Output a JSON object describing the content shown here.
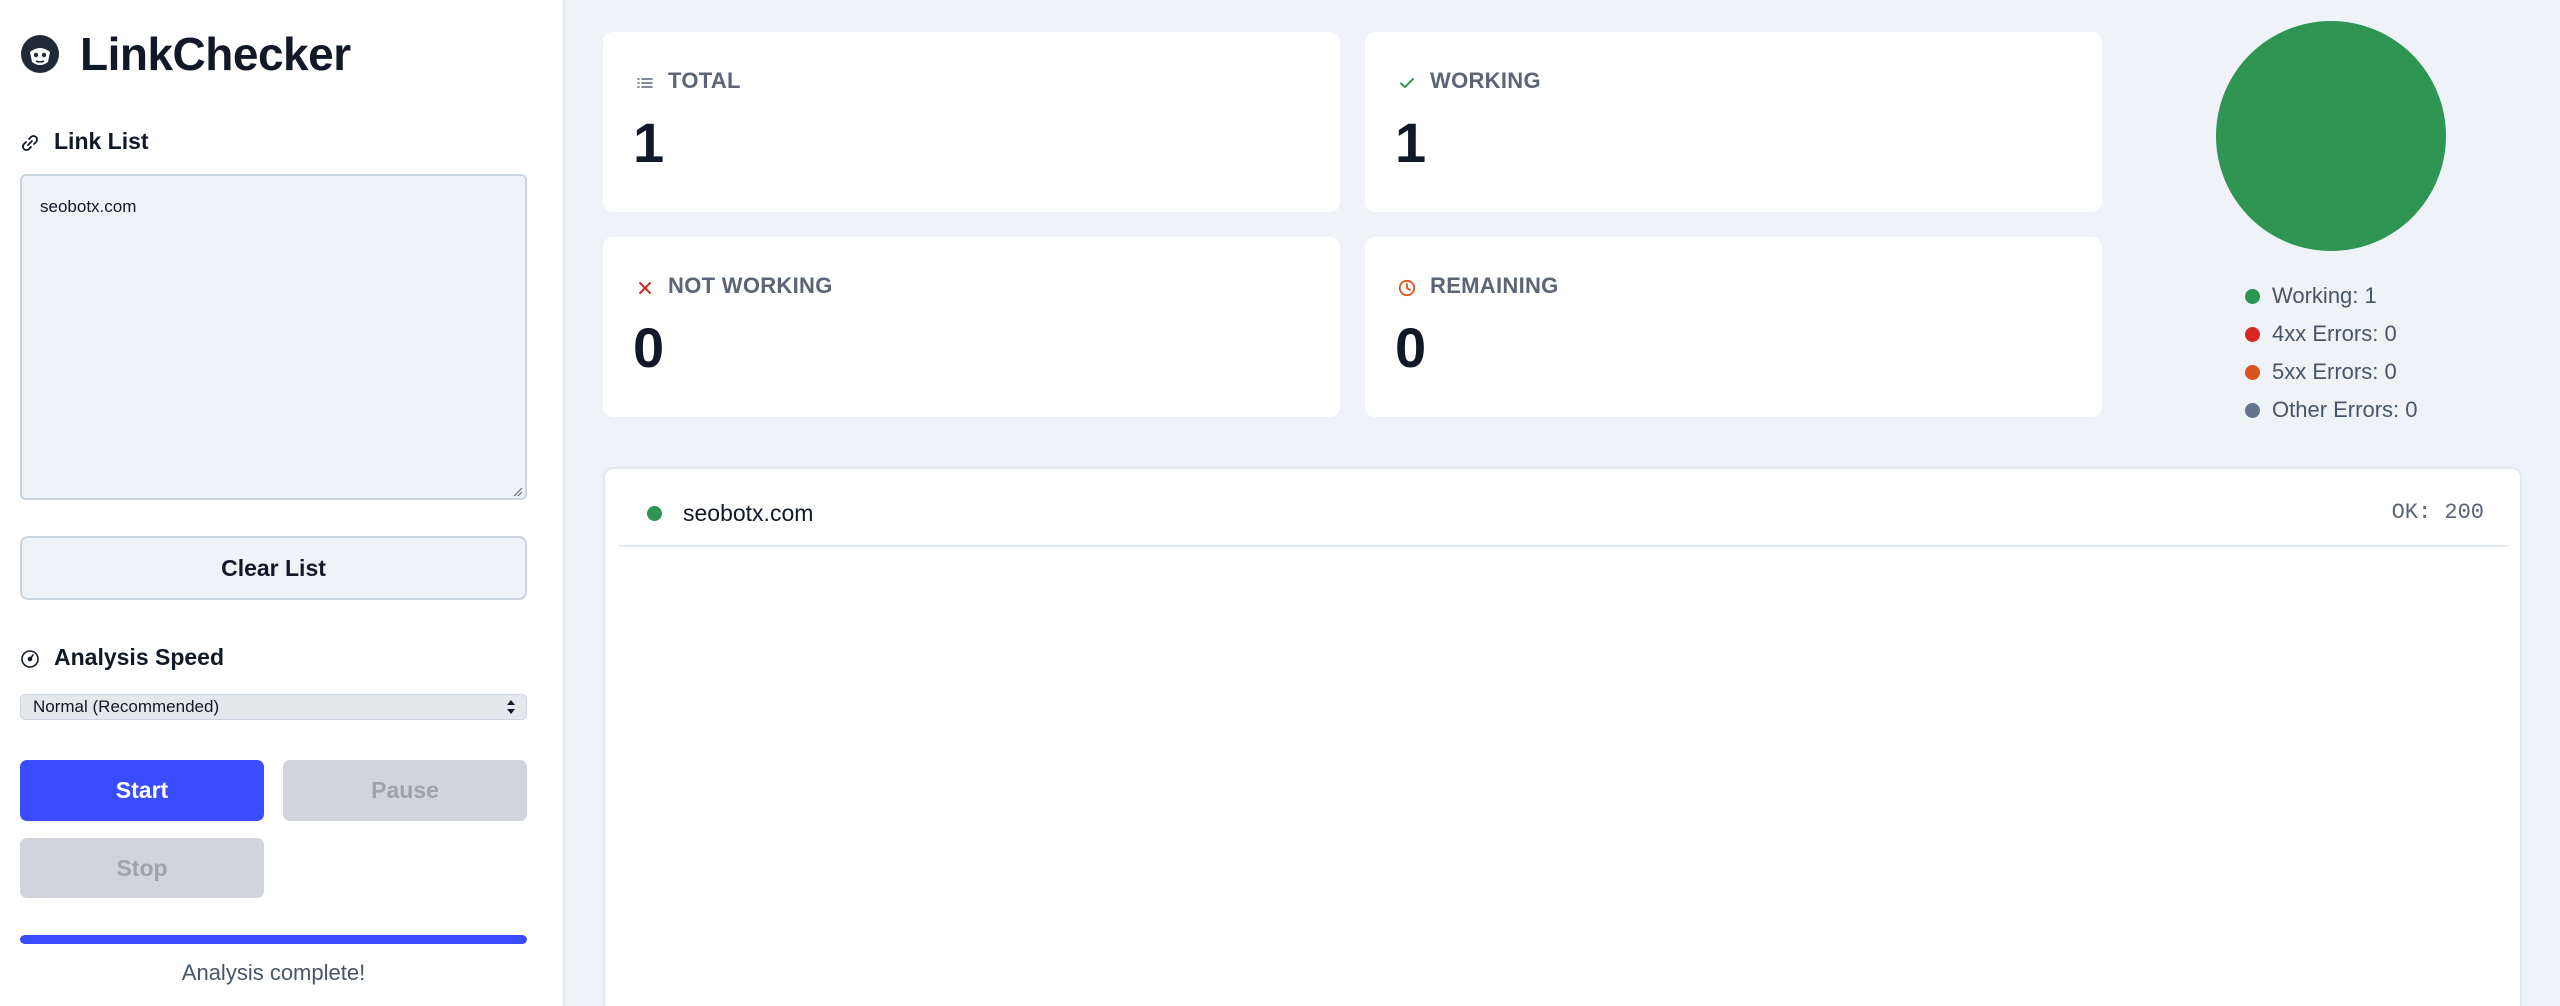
{
  "app": {
    "name": "LinkChecker"
  },
  "link_list": {
    "title": "Link List",
    "value": "seobotx.com",
    "clear_label": "Clear List"
  },
  "speed": {
    "title": "Analysis Speed",
    "selected": "Normal (Recommended)"
  },
  "controls": {
    "start": "Start",
    "pause": "Pause",
    "stop": "Stop"
  },
  "progress": {
    "percent": 100,
    "status": "Analysis complete!"
  },
  "stats": {
    "total": {
      "label": "TOTAL",
      "value": "1",
      "icon": "list-icon"
    },
    "working": {
      "label": "WORKING",
      "value": "1",
      "icon": "check-icon",
      "color": "#2f9553"
    },
    "not_working": {
      "label": "NOT WORKING",
      "value": "0",
      "icon": "x-icon",
      "color": "#dc2626"
    },
    "remaining": {
      "label": "REMAINING",
      "value": "0",
      "icon": "clock-icon",
      "color": "#d9541e"
    }
  },
  "chart": {
    "type": "pie",
    "slices": [
      {
        "name": "Working",
        "value": 1,
        "color": "#2f9553"
      },
      {
        "name": "4xx Errors",
        "value": 0,
        "color": "#dc2626"
      },
      {
        "name": "5xx Errors",
        "value": 0,
        "color": "#d9541e"
      },
      {
        "name": "Other Errors",
        "value": 0,
        "color": "#64748b"
      }
    ],
    "legend": [
      {
        "text": "Working: 1",
        "color": "#2f9553"
      },
      {
        "text": "4xx Errors: 0",
        "color": "#dc2626"
      },
      {
        "text": "5xx Errors: 0",
        "color": "#d9541e"
      },
      {
        "text": "Other Errors: 0",
        "color": "#64748b"
      }
    ]
  },
  "results": [
    {
      "url": "seobotx.com",
      "status": "OK: 200",
      "color": "#2f9553"
    }
  ]
}
